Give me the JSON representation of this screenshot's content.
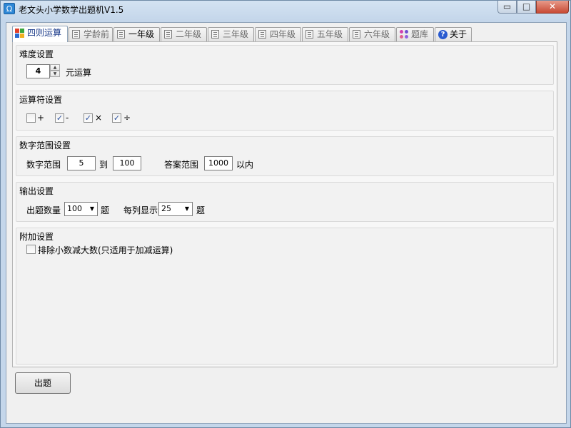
{
  "window": {
    "title": "老文头小学数学出题机V1.5",
    "icon_glyph": "Ω",
    "min_glyph": "▭",
    "max_glyph": "□",
    "close_glyph": "✕"
  },
  "tabs": [
    {
      "label": "四则运算",
      "icon": "grid-icon",
      "active": true
    },
    {
      "label": "学龄前",
      "icon": "document-icon",
      "active": false
    },
    {
      "label": "一年级",
      "icon": "document-icon",
      "active": false
    },
    {
      "label": "二年级",
      "icon": "document-icon",
      "active": false
    },
    {
      "label": "三年级",
      "icon": "document-icon",
      "active": false
    },
    {
      "label": "四年级",
      "icon": "document-icon",
      "active": false
    },
    {
      "label": "五年级",
      "icon": "document-icon",
      "active": false
    },
    {
      "label": "六年级",
      "icon": "document-icon",
      "active": false
    },
    {
      "label": "题库",
      "icon": "bank-icon",
      "active": false
    },
    {
      "label": "关于",
      "icon": "info-icon",
      "active": false
    }
  ],
  "difficulty": {
    "title": "难度设置",
    "value": "4",
    "unit_label": "元运算"
  },
  "operators": {
    "title": "运算符设置",
    "items": [
      {
        "symbol": "+",
        "checked": false
      },
      {
        "symbol": "-",
        "checked": true
      },
      {
        "symbol": "×",
        "checked": true
      },
      {
        "symbol": "÷",
        "checked": true
      }
    ],
    "check_glyph": "✓"
  },
  "number_range": {
    "title": "数字范围设置",
    "range_label": "数字范围",
    "from_value": "5",
    "to_label": "到",
    "to_value": "100",
    "answer_label": "答案范围",
    "answer_value": "1000",
    "within_label": "以内"
  },
  "output": {
    "title": "输出设置",
    "count_label": "出题数量",
    "count_value": "100",
    "count_unit": "题",
    "per_column_label": "每列显示",
    "per_column_value": "25",
    "per_column_unit": "题",
    "dropdown_glyph": "▼"
  },
  "extra": {
    "title": "附加设置",
    "exclude_label": "排除小数减大数(只适用于加减运算)",
    "exclude_checked": false
  },
  "actions": {
    "generate_label": "出题"
  },
  "colors": {
    "accent": "#1a3a8a",
    "close_button": "#c74a35"
  }
}
